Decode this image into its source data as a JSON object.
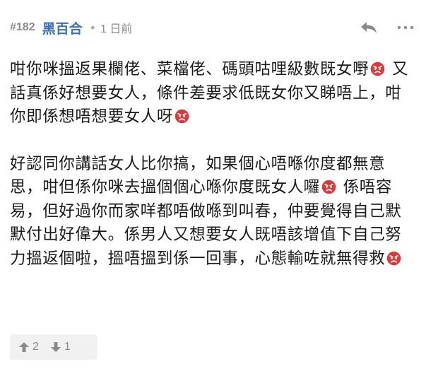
{
  "header": {
    "post_number": "#182",
    "username": "黑百合",
    "separator": "•",
    "time": "1 日前",
    "reply_icon": "reply-icon",
    "more_icon": "more-icon"
  },
  "content": {
    "paragraphs": [
      [
        "咁你咪搵返果欄佬、菜檔佬、碼頭咕哩級數既女嘢",
        "angry-emoji",
        " 又話真係好想要女人，條件差要求低既女你又睇唔上，咁你即係想唔想要女人呀",
        "angry-emoji"
      ],
      [
        "好認同你講話女人比你搞，如果個心唔喺你度都無意思，咁但係你咪去搵個個心喺你度既女人囉",
        "angry-emoji",
        " 係唔容易，但好過你而家咩都唔做喺到叫春，仲要覺得自己默默付出好偉大。係男人又想要女人既唔該增值下自己努力搵返個啦，搵唔搵到係一回事，心態輸咗就無得救",
        "angry-emoji"
      ]
    ]
  },
  "votes": {
    "upvote_icon": "arrow-up-icon",
    "upvotes": "2",
    "downvote_icon": "arrow-down-icon",
    "downvotes": "1"
  },
  "colors": {
    "username": "#3e6fb4",
    "meta": "#8a8a8a",
    "emoji_red": "#d93b3b",
    "vote_bg": "#f1f1f1"
  }
}
